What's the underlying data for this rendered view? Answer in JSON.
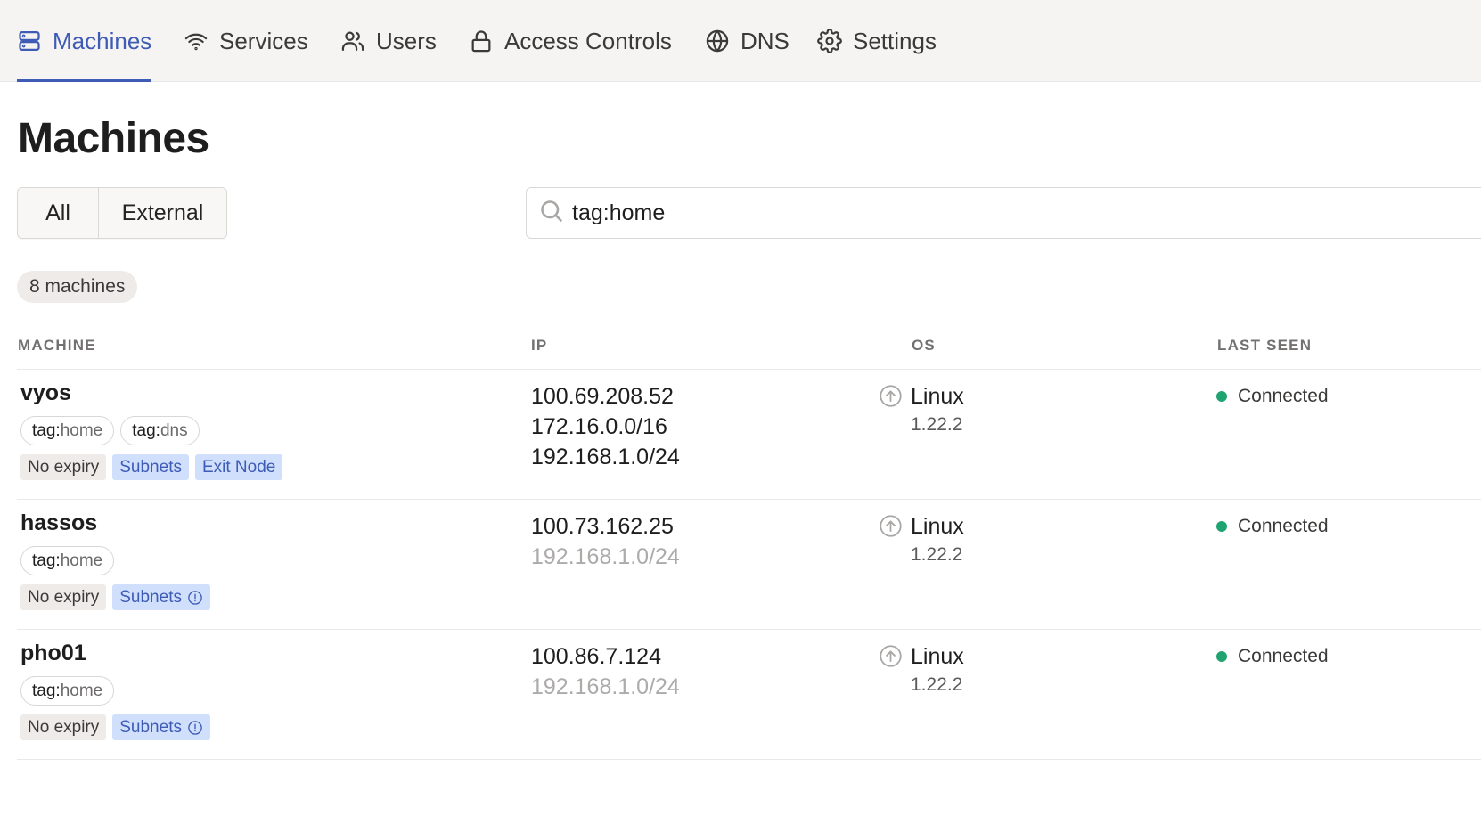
{
  "nav": {
    "items": [
      {
        "label": "Machines",
        "icon": "server-icon",
        "active": true
      },
      {
        "label": "Services",
        "icon": "wifi-icon",
        "active": false
      },
      {
        "label": "Users",
        "icon": "users-icon",
        "active": false
      },
      {
        "label": "Access Controls",
        "icon": "lock-icon",
        "active": false
      },
      {
        "label": "DNS",
        "icon": "globe-icon",
        "active": false
      },
      {
        "label": "Settings",
        "icon": "gear-icon",
        "active": false
      }
    ]
  },
  "page": {
    "title": "Machines"
  },
  "filter": {
    "options": [
      "All",
      "External"
    ]
  },
  "search": {
    "value": "tag:home",
    "icon": "search-icon"
  },
  "count": "8 machines",
  "table": {
    "columns": [
      "MACHINE",
      "IP",
      "OS",
      "LAST SEEN"
    ],
    "rows": [
      {
        "name": "vyos",
        "tags": [
          {
            "prefix": "tag:",
            "value": "home"
          },
          {
            "prefix": "tag:",
            "value": "dns"
          }
        ],
        "badges": [
          {
            "label": "No expiry",
            "style": "neutral",
            "info": false
          },
          {
            "label": "Subnets",
            "style": "blue",
            "info": false
          },
          {
            "label": "Exit Node",
            "style": "blue",
            "info": false
          }
        ],
        "ips": [
          {
            "value": "100.69.208.52",
            "muted": false
          },
          {
            "value": "172.16.0.0/16",
            "muted": false
          },
          {
            "value": "192.168.1.0/24",
            "muted": false
          }
        ],
        "os": "Linux",
        "version": "1.22.2",
        "status": "Connected"
      },
      {
        "name": "hassos",
        "tags": [
          {
            "prefix": "tag:",
            "value": "home"
          }
        ],
        "badges": [
          {
            "label": "No expiry",
            "style": "neutral",
            "info": false
          },
          {
            "label": "Subnets",
            "style": "blue",
            "info": true
          }
        ],
        "ips": [
          {
            "value": "100.73.162.25",
            "muted": false
          },
          {
            "value": "192.168.1.0/24",
            "muted": true
          }
        ],
        "os": "Linux",
        "version": "1.22.2",
        "status": "Connected"
      },
      {
        "name": "pho01",
        "tags": [
          {
            "prefix": "tag:",
            "value": "home"
          }
        ],
        "badges": [
          {
            "label": "No expiry",
            "style": "neutral",
            "info": false
          },
          {
            "label": "Subnets",
            "style": "blue",
            "info": true
          }
        ],
        "ips": [
          {
            "value": "100.86.7.124",
            "muted": false
          },
          {
            "value": "192.168.1.0/24",
            "muted": true
          }
        ],
        "os": "Linux",
        "version": "1.22.2",
        "status": "Connected"
      }
    ]
  },
  "colors": {
    "accent": "#3e5bb5",
    "connected": "#1fa370",
    "badge_blue_bg": "#cfdffc"
  }
}
